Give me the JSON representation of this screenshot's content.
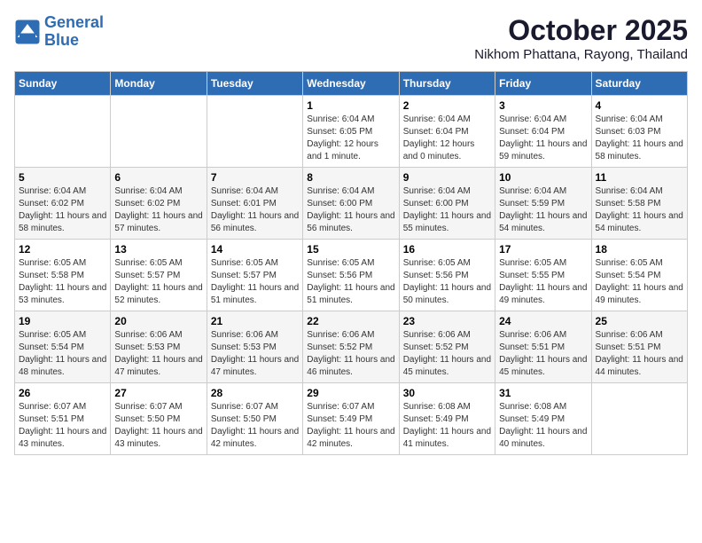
{
  "header": {
    "logo_line1": "General",
    "logo_line2": "Blue",
    "month": "October 2025",
    "location": "Nikhom Phattana, Rayong, Thailand"
  },
  "days_of_week": [
    "Sunday",
    "Monday",
    "Tuesday",
    "Wednesday",
    "Thursday",
    "Friday",
    "Saturday"
  ],
  "weeks": [
    [
      {
        "date": "",
        "sunrise": "",
        "sunset": "",
        "daylight": ""
      },
      {
        "date": "",
        "sunrise": "",
        "sunset": "",
        "daylight": ""
      },
      {
        "date": "",
        "sunrise": "",
        "sunset": "",
        "daylight": ""
      },
      {
        "date": "1",
        "sunrise": "Sunrise: 6:04 AM",
        "sunset": "Sunset: 6:05 PM",
        "daylight": "Daylight: 12 hours and 1 minute."
      },
      {
        "date": "2",
        "sunrise": "Sunrise: 6:04 AM",
        "sunset": "Sunset: 6:04 PM",
        "daylight": "Daylight: 12 hours and 0 minutes."
      },
      {
        "date": "3",
        "sunrise": "Sunrise: 6:04 AM",
        "sunset": "Sunset: 6:04 PM",
        "daylight": "Daylight: 11 hours and 59 minutes."
      },
      {
        "date": "4",
        "sunrise": "Sunrise: 6:04 AM",
        "sunset": "Sunset: 6:03 PM",
        "daylight": "Daylight: 11 hours and 58 minutes."
      }
    ],
    [
      {
        "date": "5",
        "sunrise": "Sunrise: 6:04 AM",
        "sunset": "Sunset: 6:02 PM",
        "daylight": "Daylight: 11 hours and 58 minutes."
      },
      {
        "date": "6",
        "sunrise": "Sunrise: 6:04 AM",
        "sunset": "Sunset: 6:02 PM",
        "daylight": "Daylight: 11 hours and 57 minutes."
      },
      {
        "date": "7",
        "sunrise": "Sunrise: 6:04 AM",
        "sunset": "Sunset: 6:01 PM",
        "daylight": "Daylight: 11 hours and 56 minutes."
      },
      {
        "date": "8",
        "sunrise": "Sunrise: 6:04 AM",
        "sunset": "Sunset: 6:00 PM",
        "daylight": "Daylight: 11 hours and 56 minutes."
      },
      {
        "date": "9",
        "sunrise": "Sunrise: 6:04 AM",
        "sunset": "Sunset: 6:00 PM",
        "daylight": "Daylight: 11 hours and 55 minutes."
      },
      {
        "date": "10",
        "sunrise": "Sunrise: 6:04 AM",
        "sunset": "Sunset: 5:59 PM",
        "daylight": "Daylight: 11 hours and 54 minutes."
      },
      {
        "date": "11",
        "sunrise": "Sunrise: 6:04 AM",
        "sunset": "Sunset: 5:58 PM",
        "daylight": "Daylight: 11 hours and 54 minutes."
      }
    ],
    [
      {
        "date": "12",
        "sunrise": "Sunrise: 6:05 AM",
        "sunset": "Sunset: 5:58 PM",
        "daylight": "Daylight: 11 hours and 53 minutes."
      },
      {
        "date": "13",
        "sunrise": "Sunrise: 6:05 AM",
        "sunset": "Sunset: 5:57 PM",
        "daylight": "Daylight: 11 hours and 52 minutes."
      },
      {
        "date": "14",
        "sunrise": "Sunrise: 6:05 AM",
        "sunset": "Sunset: 5:57 PM",
        "daylight": "Daylight: 11 hours and 51 minutes."
      },
      {
        "date": "15",
        "sunrise": "Sunrise: 6:05 AM",
        "sunset": "Sunset: 5:56 PM",
        "daylight": "Daylight: 11 hours and 51 minutes."
      },
      {
        "date": "16",
        "sunrise": "Sunrise: 6:05 AM",
        "sunset": "Sunset: 5:56 PM",
        "daylight": "Daylight: 11 hours and 50 minutes."
      },
      {
        "date": "17",
        "sunrise": "Sunrise: 6:05 AM",
        "sunset": "Sunset: 5:55 PM",
        "daylight": "Daylight: 11 hours and 49 minutes."
      },
      {
        "date": "18",
        "sunrise": "Sunrise: 6:05 AM",
        "sunset": "Sunset: 5:54 PM",
        "daylight": "Daylight: 11 hours and 49 minutes."
      }
    ],
    [
      {
        "date": "19",
        "sunrise": "Sunrise: 6:05 AM",
        "sunset": "Sunset: 5:54 PM",
        "daylight": "Daylight: 11 hours and 48 minutes."
      },
      {
        "date": "20",
        "sunrise": "Sunrise: 6:06 AM",
        "sunset": "Sunset: 5:53 PM",
        "daylight": "Daylight: 11 hours and 47 minutes."
      },
      {
        "date": "21",
        "sunrise": "Sunrise: 6:06 AM",
        "sunset": "Sunset: 5:53 PM",
        "daylight": "Daylight: 11 hours and 47 minutes."
      },
      {
        "date": "22",
        "sunrise": "Sunrise: 6:06 AM",
        "sunset": "Sunset: 5:52 PM",
        "daylight": "Daylight: 11 hours and 46 minutes."
      },
      {
        "date": "23",
        "sunrise": "Sunrise: 6:06 AM",
        "sunset": "Sunset: 5:52 PM",
        "daylight": "Daylight: 11 hours and 45 minutes."
      },
      {
        "date": "24",
        "sunrise": "Sunrise: 6:06 AM",
        "sunset": "Sunset: 5:51 PM",
        "daylight": "Daylight: 11 hours and 45 minutes."
      },
      {
        "date": "25",
        "sunrise": "Sunrise: 6:06 AM",
        "sunset": "Sunset: 5:51 PM",
        "daylight": "Daylight: 11 hours and 44 minutes."
      }
    ],
    [
      {
        "date": "26",
        "sunrise": "Sunrise: 6:07 AM",
        "sunset": "Sunset: 5:51 PM",
        "daylight": "Daylight: 11 hours and 43 minutes."
      },
      {
        "date": "27",
        "sunrise": "Sunrise: 6:07 AM",
        "sunset": "Sunset: 5:50 PM",
        "daylight": "Daylight: 11 hours and 43 minutes."
      },
      {
        "date": "28",
        "sunrise": "Sunrise: 6:07 AM",
        "sunset": "Sunset: 5:50 PM",
        "daylight": "Daylight: 11 hours and 42 minutes."
      },
      {
        "date": "29",
        "sunrise": "Sunrise: 6:07 AM",
        "sunset": "Sunset: 5:49 PM",
        "daylight": "Daylight: 11 hours and 42 minutes."
      },
      {
        "date": "30",
        "sunrise": "Sunrise: 6:08 AM",
        "sunset": "Sunset: 5:49 PM",
        "daylight": "Daylight: 11 hours and 41 minutes."
      },
      {
        "date": "31",
        "sunrise": "Sunrise: 6:08 AM",
        "sunset": "Sunset: 5:49 PM",
        "daylight": "Daylight: 11 hours and 40 minutes."
      },
      {
        "date": "",
        "sunrise": "",
        "sunset": "",
        "daylight": ""
      }
    ]
  ]
}
